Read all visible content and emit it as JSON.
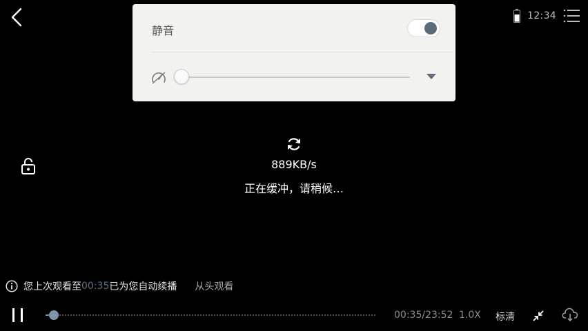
{
  "status": {
    "time": "12:34"
  },
  "volume_panel": {
    "mute_label": "静音",
    "mute_enabled": true
  },
  "loading": {
    "speed": "889KB/s",
    "message": "正在缓冲，请稍候…"
  },
  "resume": {
    "prefix": "您上次观看至",
    "time": "00:35",
    "suffix": "已为您自动续播",
    "restart_label": "从头观看"
  },
  "controls": {
    "current_time": "00:35",
    "duration": "23:52",
    "time_display": "00:35/23:52",
    "rate": "1.0X",
    "quality": "标清"
  },
  "colors": {
    "accent": "#7f95ab",
    "panel_bg": "#f2f2ef"
  },
  "icons": [
    "back-icon",
    "battery-icon",
    "menu-icon",
    "speedometer-icon",
    "chevron-down-icon",
    "refresh-icon",
    "lock-icon",
    "info-icon",
    "pause-icon",
    "shrink-icon",
    "cloud-download-icon"
  ]
}
